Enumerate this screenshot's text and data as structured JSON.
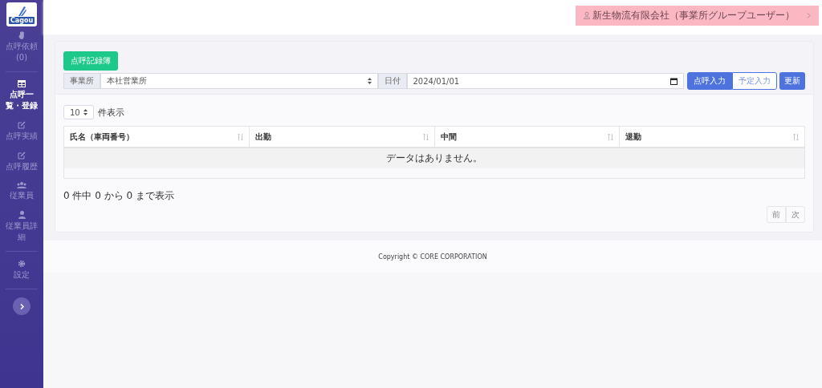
{
  "logo": {
    "text": "Cagou"
  },
  "sidebar": {
    "items": [
      {
        "kind": "hand",
        "label": "点呼依頼\n(0)",
        "selected": false
      },
      {
        "kind": "table",
        "label": "点呼一覧・登録",
        "selected": true
      },
      {
        "kind": "edit",
        "label": "点呼実績",
        "selected": false
      },
      {
        "kind": "edit",
        "label": "点呼履歴",
        "selected": false
      },
      {
        "kind": "group",
        "label": "従業員",
        "selected": false
      },
      {
        "kind": "user",
        "label": "従業員詳細",
        "selected": false
      },
      {
        "kind": "gear",
        "label": "設定",
        "selected": false
      }
    ]
  },
  "header": {
    "user": "新生物流有限会社（事業所グループユーザー）"
  },
  "record_button": "点呼記録簿",
  "filters": {
    "office_label": "事業所",
    "office_value": "本社営業所",
    "date_label": "日付",
    "date_value": "2024/01/01"
  },
  "modes": [
    {
      "label": "点呼入力",
      "selected": true
    },
    {
      "label": "予定入力",
      "selected": false
    }
  ],
  "refresh_button": "更新",
  "page_size": {
    "value": "10",
    "label": "件表示"
  },
  "table": {
    "columns": [
      "氏名（車両番号）",
      "出勤",
      "中間",
      "退勤"
    ],
    "empty": "データはありません。"
  },
  "info": "0 件中 0 から 0 まで表示",
  "pager": [
    "前",
    "次"
  ],
  "footer": "Copyright © CORE CORPORATION"
}
